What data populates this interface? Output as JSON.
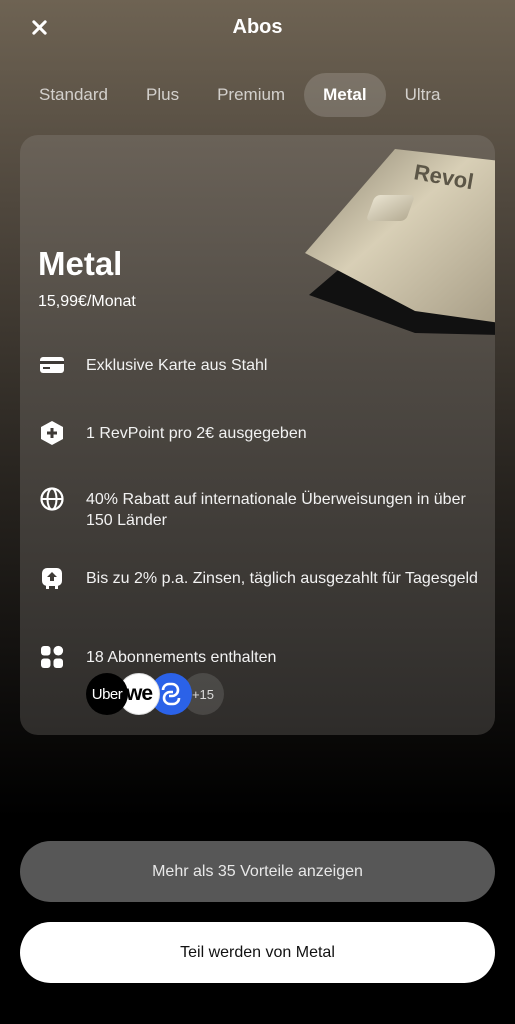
{
  "header": {
    "title": "Abos"
  },
  "tabs": [
    {
      "label": "Standard",
      "active": false
    },
    {
      "label": "Plus",
      "active": false
    },
    {
      "label": "Premium",
      "active": false
    },
    {
      "label": "Metal",
      "active": true
    },
    {
      "label": "Ultra",
      "active": false
    }
  ],
  "plan": {
    "name": "Metal",
    "price": "15,99€/Monat",
    "card_brand": "Revol"
  },
  "features": [
    {
      "icon": "card-icon",
      "text": "Exklusive Karte aus Stahl"
    },
    {
      "icon": "revpoint-icon",
      "text": "1 RevPoint pro 2€ ausgegeben"
    },
    {
      "icon": "globe-icon",
      "text": "40% Rabatt auf internationale Überweisungen in über 150 Länder"
    },
    {
      "icon": "savings-icon",
      "text": "Bis zu 2% p.a. Zinsen, täglich ausgezahlt für Tagesgeld"
    },
    {
      "icon": "apps-icon",
      "text": "18 Abonnements enthalten"
    }
  ],
  "subscriptions": {
    "logos": [
      "Uber",
      "we"
    ],
    "more": "+15"
  },
  "buttons": {
    "more_benefits": "Mehr als 35 Vorteile anzeigen",
    "join": "Teil werden von Metal"
  }
}
